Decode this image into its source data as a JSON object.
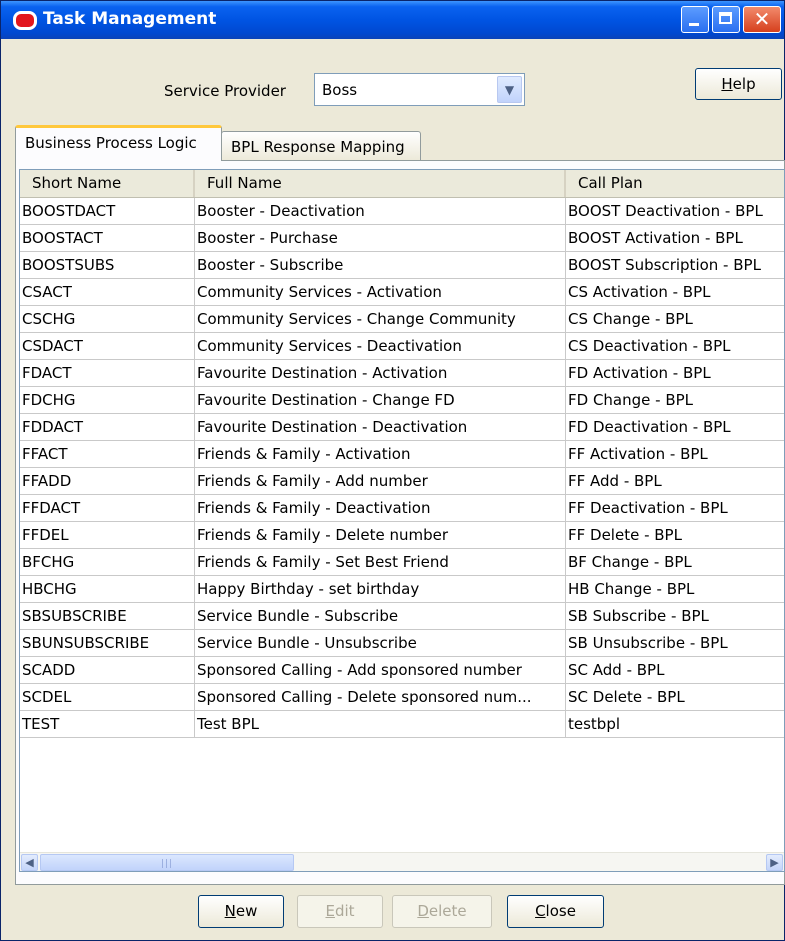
{
  "window": {
    "title": "Task Management"
  },
  "service_provider": {
    "label": "Service Provider",
    "value": "Boss"
  },
  "help_button": {
    "mnemonic": "H",
    "rest": "elp"
  },
  "tabs": [
    {
      "label": "Business Process Logic",
      "active": true
    },
    {
      "label": "BPL Response Mapping",
      "active": false
    }
  ],
  "table": {
    "columns": [
      "Short Name",
      "Full Name",
      "Call Plan"
    ],
    "rows": [
      [
        "BOOSTDACT",
        "Booster - Deactivation",
        "BOOST Deactivation - BPL"
      ],
      [
        "BOOSTACT",
        "Booster - Purchase",
        "BOOST Activation - BPL"
      ],
      [
        "BOOSTSUBS",
        "Booster - Subscribe",
        "BOOST Subscription - BPL"
      ],
      [
        "CSACT",
        "Community Services - Activation",
        "CS Activation - BPL"
      ],
      [
        "CSCHG",
        "Community Services - Change Community",
        "CS Change - BPL"
      ],
      [
        "CSDACT",
        "Community Services - Deactivation",
        "CS Deactivation - BPL"
      ],
      [
        "FDACT",
        "Favourite Destination - Activation",
        "FD Activation - BPL"
      ],
      [
        "FDCHG",
        "Favourite Destination - Change FD",
        "FD Change - BPL"
      ],
      [
        "FDDACT",
        "Favourite Destination - Deactivation",
        "FD Deactivation - BPL"
      ],
      [
        "FFACT",
        "Friends & Family - Activation",
        "FF Activation - BPL"
      ],
      [
        "FFADD",
        "Friends & Family - Add number",
        "FF Add - BPL"
      ],
      [
        "FFDACT",
        "Friends & Family - Deactivation",
        "FF Deactivation - BPL"
      ],
      [
        "FFDEL",
        "Friends & Family - Delete number",
        "FF Delete - BPL"
      ],
      [
        "BFCHG",
        "Friends & Family - Set Best Friend",
        "BF Change - BPL"
      ],
      [
        "HBCHG",
        "Happy Birthday - set birthday",
        "HB Change - BPL"
      ],
      [
        "SBSUBSCRIBE",
        "Service Bundle - Subscribe",
        "SB Subscribe - BPL"
      ],
      [
        "SBUNSUBSCRIBE",
        "Service Bundle - Unsubscribe",
        "SB Unsubscribe - BPL"
      ],
      [
        "SCADD",
        "Sponsored Calling - Add sponsored number",
        "SC Add - BPL"
      ],
      [
        "SCDEL",
        "Sponsored Calling - Delete sponsored num...",
        "SC Delete - BPL"
      ],
      [
        "TEST",
        "Test BPL",
        "testbpl"
      ]
    ]
  },
  "buttons": [
    {
      "name": "new-button",
      "mnemonic": "N",
      "rest": "ew",
      "enabled": true
    },
    {
      "name": "edit-button",
      "mnemonic": "E",
      "rest": "dit",
      "enabled": false
    },
    {
      "name": "delete-button",
      "mnemonic": "D",
      "rest": "elete",
      "enabled": false
    },
    {
      "name": "close-button",
      "mnemonic": "C",
      "rest": "lose",
      "enabled": true
    }
  ],
  "icons": {
    "app": "oracle-logo-icon",
    "minimize": "minimize-icon",
    "maximize": "maximize-icon",
    "close": "close-icon",
    "dropdown": "chevron-down-icon",
    "scroll_left": "scroll-left-icon",
    "scroll_right": "scroll-right-icon"
  },
  "colors": {
    "titlebar": "#0054e3",
    "tab_highlight": "#ffc83c",
    "window_bg": "#ece9d8"
  }
}
